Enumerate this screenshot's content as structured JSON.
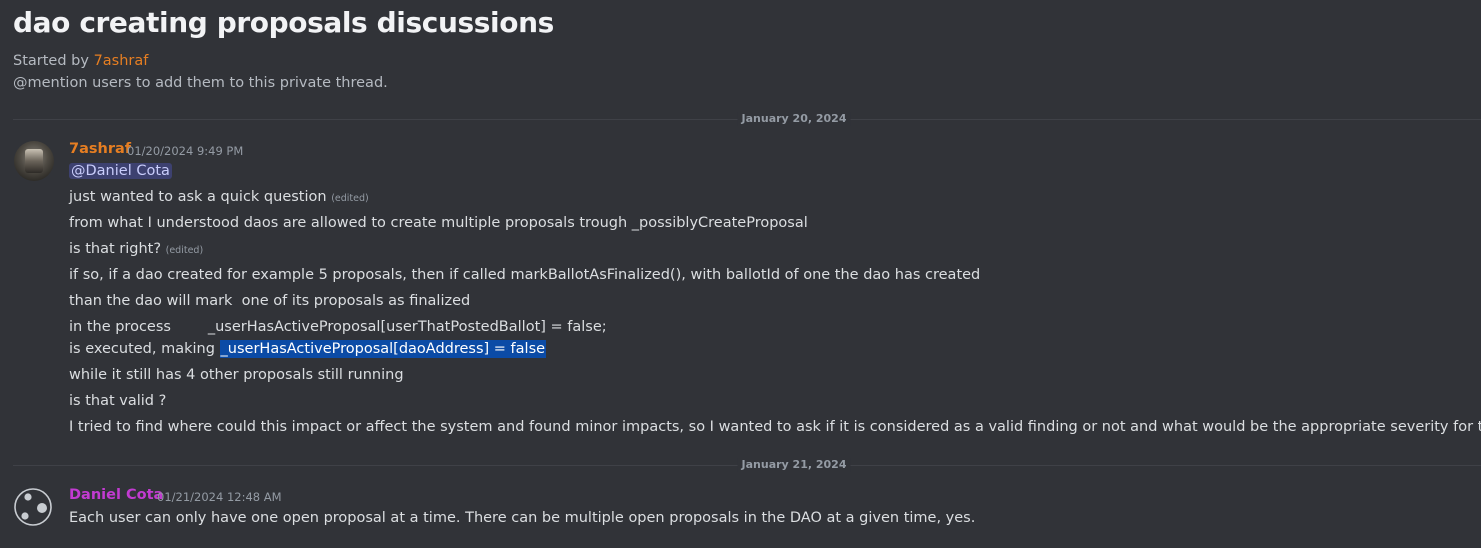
{
  "thread": {
    "title": "dao creating proposals discussions",
    "started_prefix": "Started by ",
    "started_user": "7ashraf",
    "mention_hint": "@mention users to add them to this private thread."
  },
  "dividers": [
    "January 20, 2024",
    "January 21, 2024"
  ],
  "messages": [
    {
      "author": "7ashraf",
      "author_color": "#e67e22",
      "timestamp": "01/20/2024 9:49 PM",
      "avatar": "user-photo-avatar",
      "lines": {
        "mention": "@Daniel Cota",
        "l1": "just wanted to ask a quick question",
        "l1_edited": "(edited)",
        "l2": "from what I understood daos are allowed to create multiple proposals trough _possiblyCreateProposal",
        "l3": "is that right?",
        "l3_edited": "(edited)",
        "l4": "if so, if a dao created for example 5 proposals, then if called markBallotAsFinalized(), with ballotId of one the dao has created",
        "l5": "than the dao will mark  one of its proposals as finalized",
        "l6": "in the process        _userHasActiveProposal[userThatPostedBallot] = false;",
        "l7_prefix": "is executed, making ",
        "l7_highlight": "_userHasActiveProposal[daoAddress] = false",
        "l8": "while it still has 4 other proposals still running",
        "l9": "is that valid ?",
        "l10": "I tried to find where could this impact or affect the system and found minor impacts, so I wanted to ask if it is considered as a valid finding or not and what would be the appropriate severity for this."
      }
    },
    {
      "author": "Daniel Cota",
      "author_color": "#c23bd1",
      "timestamp": "01/21/2024 12:48 AM",
      "avatar": "default-discord-avatar",
      "lines": {
        "l1": "Each user can only have one open proposal at a time. There can be multiple open proposals in the DAO at a given time, yes."
      }
    }
  ],
  "colors": {
    "background": "#313338",
    "text": "#dbdee1",
    "muted": "#949ba4",
    "selection": "#0b4ba6",
    "mention_bg": "rgba(88,101,242,0.3)"
  }
}
